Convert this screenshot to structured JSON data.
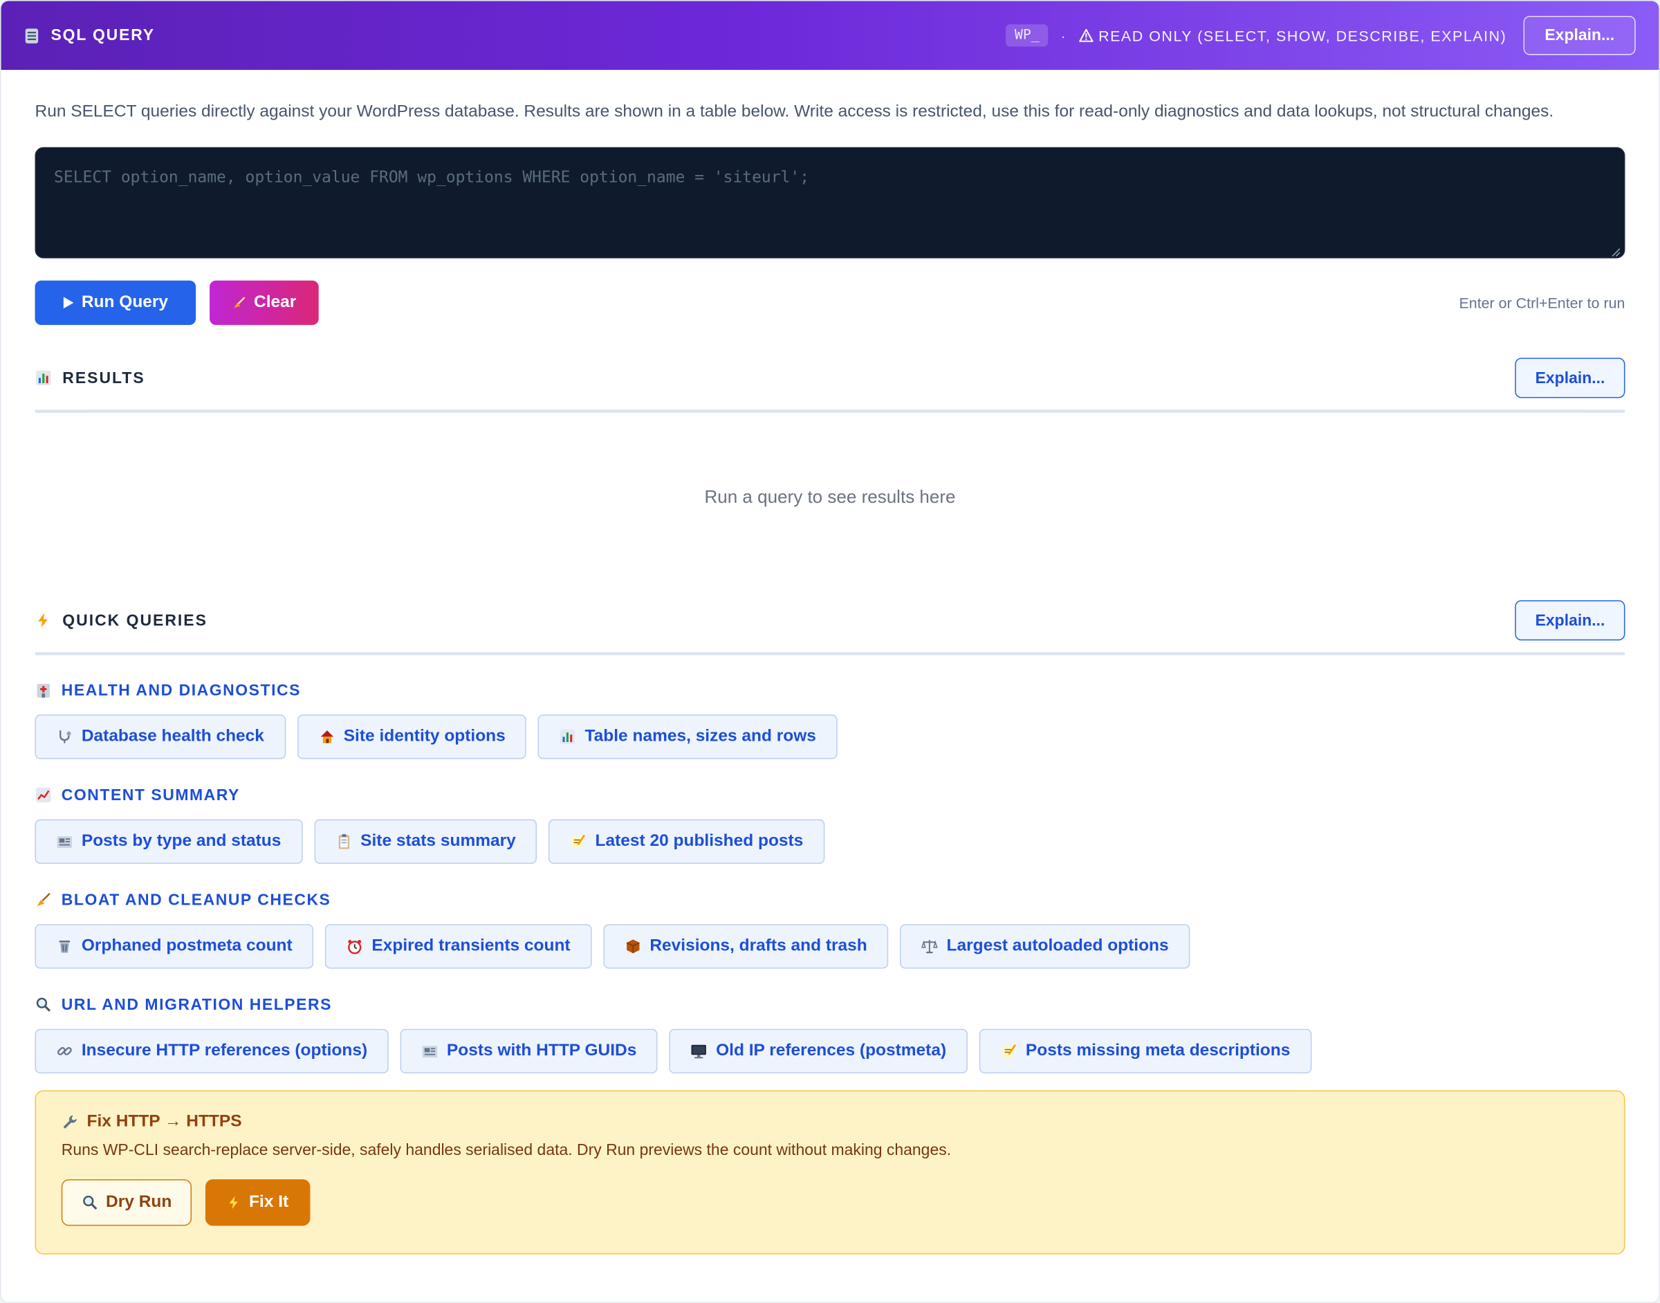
{
  "header": {
    "title": "SQL QUERY",
    "prefix": "WP_",
    "separator": "·",
    "mode_text": "READ ONLY (SELECT, SHOW, DESCRIBE, EXPLAIN)",
    "explain_label": "Explain..."
  },
  "description": "Run SELECT queries directly against your WordPress database. Results are shown in a table below. Write access is restricted, use this for read-only diagnostics and data lookups, not structural changes.",
  "editor": {
    "value": "",
    "placeholder": "SELECT option_name, option_value FROM wp_options WHERE option_name = 'siteurl';"
  },
  "toolbar": {
    "run_label": "Run Query",
    "clear_label": "Clear",
    "hint": "Enter or Ctrl+Enter to run"
  },
  "results": {
    "title": "RESULTS",
    "explain_label": "Explain...",
    "empty_text": "Run a query to see results here"
  },
  "quick": {
    "title": "QUICK QUERIES",
    "explain_label": "Explain...",
    "groups": [
      {
        "title": "HEALTH AND DIAGNOSTICS",
        "icon": "hospital-icon",
        "items": [
          {
            "label": "Database health check",
            "icon": "stethoscope-icon"
          },
          {
            "label": "Site identity options",
            "icon": "house-icon"
          },
          {
            "label": "Table names, sizes and rows",
            "icon": "bar-chart-icon"
          }
        ]
      },
      {
        "title": "CONTENT SUMMARY",
        "icon": "trend-chart-icon",
        "items": [
          {
            "label": "Posts by type and status",
            "icon": "newspaper-icon"
          },
          {
            "label": "Site stats summary",
            "icon": "clipboard-icon"
          },
          {
            "label": "Latest 20 published posts",
            "icon": "memo-icon"
          }
        ]
      },
      {
        "title": "BLOAT AND CLEANUP CHECKS",
        "icon": "broom-icon",
        "items": [
          {
            "label": "Orphaned postmeta count",
            "icon": "trash-icon"
          },
          {
            "label": "Expired transients count",
            "icon": "alarm-clock-icon"
          },
          {
            "label": "Revisions, drafts and trash",
            "icon": "package-icon"
          },
          {
            "label": "Largest autoloaded options",
            "icon": "scales-icon"
          }
        ]
      },
      {
        "title": "URL AND MIGRATION HELPERS",
        "icon": "magnifier-icon",
        "items": [
          {
            "label": "Insecure HTTP references (options)",
            "icon": "link-icon"
          },
          {
            "label": "Posts with HTTP GUIDs",
            "icon": "newspaper-icon"
          },
          {
            "label": "Old IP references (postmeta)",
            "icon": "monitor-icon"
          },
          {
            "label": "Posts missing meta descriptions",
            "icon": "memo-icon"
          }
        ]
      }
    ]
  },
  "fix": {
    "title": "Fix HTTP → HTTPS",
    "description": "Runs WP-CLI search-replace server-side, safely handles serialised data. Dry Run previews the count without making changes.",
    "dry_run_label": "Dry Run",
    "fix_label": "Fix It"
  },
  "colors": {
    "header_start": "#5b21b6",
    "header_end": "#8b5cf6",
    "primary": "#2563eb",
    "clear_start": "#c026d3",
    "clear_end": "#db2777",
    "link_blue": "#1d4ed8",
    "warning_bg": "#fef3c7",
    "warning_accent": "#d97706"
  }
}
